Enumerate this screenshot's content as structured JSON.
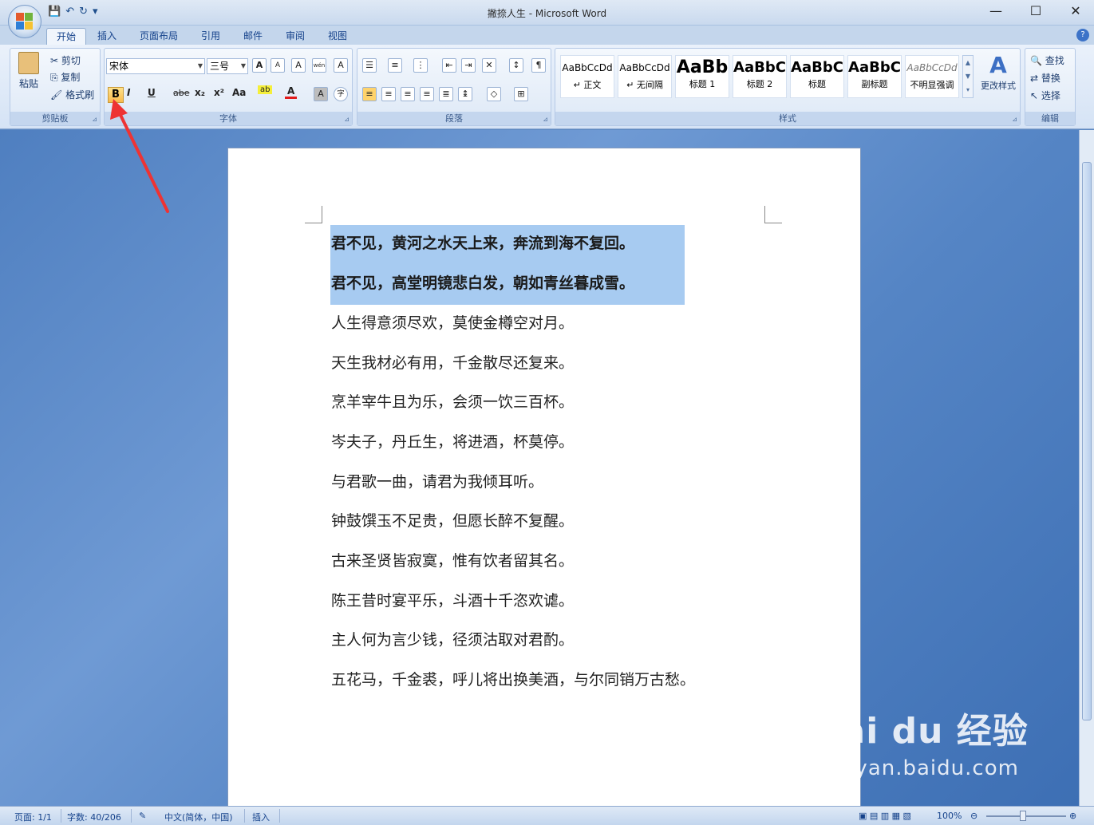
{
  "window": {
    "title": "撇捺人生 - Microsoft Word",
    "min": "—",
    "max": "☐",
    "close": "✕"
  },
  "quick_access": {
    "save": "💾",
    "undo": "↶",
    "redo": "↻",
    "more": "▾"
  },
  "tabs": [
    "开始",
    "插入",
    "页面布局",
    "引用",
    "邮件",
    "审阅",
    "视图"
  ],
  "help": "?",
  "clipboard": {
    "paste": "粘贴",
    "cut": "剪切",
    "copy": "复制",
    "format_painter": "格式刷",
    "group_label": "剪贴板"
  },
  "font": {
    "name": "宋体",
    "size": "三号",
    "group_label": "字体",
    "grow": "A",
    "shrink": "A",
    "clear": "A",
    "phonetic": "wén",
    "border": "A",
    "bold": "B",
    "italic": "I",
    "underline": "U",
    "strike": "abe",
    "subscript": "x₂",
    "superscript": "x²",
    "case": "Aa",
    "highlight": "ab",
    "color": "A",
    "shade": "A",
    "enclose": "字"
  },
  "paragraph": {
    "group_label": "段落"
  },
  "styles": {
    "group_label": "样式",
    "items": [
      {
        "sample": "AaBbCcDd",
        "name": "↵ 正文"
      },
      {
        "sample": "AaBbCcDd",
        "name": "↵ 无间隔"
      },
      {
        "sample": "AaBb",
        "name": "标题 1"
      },
      {
        "sample": "AaBbC",
        "name": "标题 2"
      },
      {
        "sample": "AaBbC",
        "name": "标题"
      },
      {
        "sample": "AaBbC",
        "name": "副标题"
      },
      {
        "sample": "AaBbCcDd",
        "name": "不明显强调"
      }
    ],
    "change": "更改样式"
  },
  "editing": {
    "find": "查找",
    "replace": "替换",
    "select": "选择",
    "group_label": "编辑"
  },
  "document": {
    "lines": [
      "君不见，黄河之水天上来，奔流到海不复回。",
      "君不见，高堂明镜悲白发，朝如青丝暮成雪。",
      "人生得意须尽欢，莫使金樽空对月。",
      "天生我材必有用，千金散尽还复来。",
      "烹羊宰牛且为乐，会须一饮三百杯。",
      "岑夫子，丹丘生，将进酒，杯莫停。",
      "与君歌一曲，请君为我倾耳听。",
      "钟鼓馔玉不足贵，但愿长醉不复醒。",
      "古来圣贤皆寂寞，惟有饮者留其名。",
      "陈王昔时宴平乐，斗酒十千恣欢谑。",
      "主人何为言少钱，径须沽取对君酌。",
      "五花马，千金裘，呼儿将出换美酒，与尔同销万古愁。"
    ]
  },
  "status": {
    "page": "页面: 1/1",
    "words": "字数: 40/206",
    "language": "中文(简体，中国)",
    "mode": "插入",
    "zoom": "100%"
  },
  "watermark": {
    "main": "Bai du 经验",
    "sub": "jingyan.baidu.com"
  }
}
